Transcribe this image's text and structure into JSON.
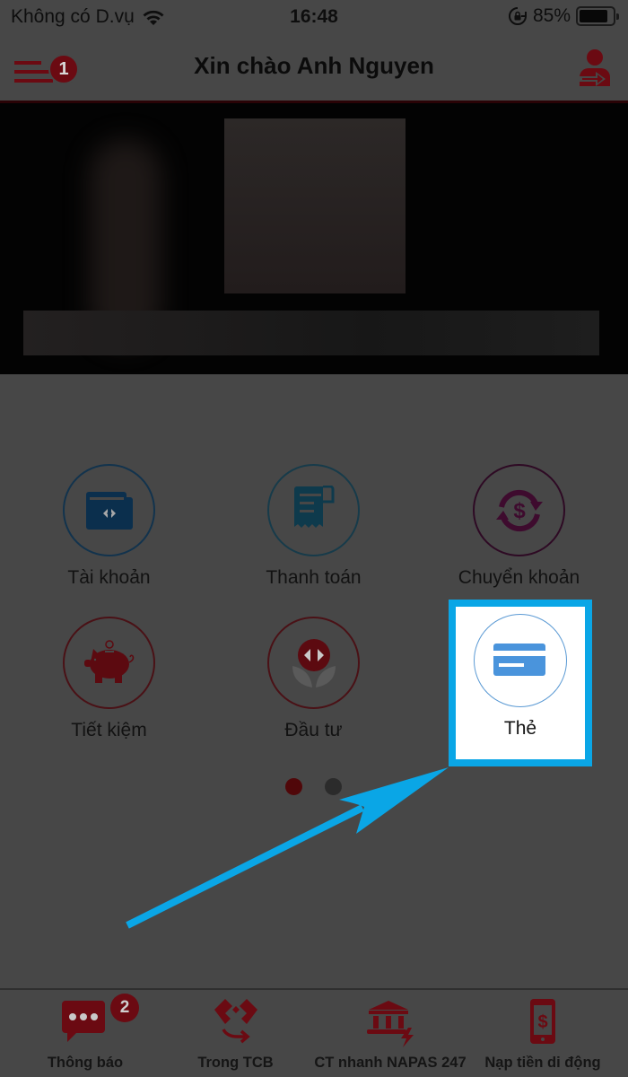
{
  "status_bar": {
    "carrier": "Không có D.vụ",
    "time": "16:48",
    "battery_percent_label": "85%",
    "battery_level": 0.85,
    "icons": [
      "wifi-icon",
      "rotation-lock-icon",
      "battery-icon"
    ]
  },
  "header": {
    "title": "Xin chào Anh Nguyen",
    "menu_badge": "1",
    "menu_icon": "hamburger-menu-icon",
    "logout_icon": "user-logout-icon"
  },
  "colors": {
    "brand_red": "#6b0a12",
    "overlay_bg": "#474747",
    "highlight_blue": "#0aa6e6",
    "card_blue": "#5b9ad4",
    "account_blue": "#0b2f4d",
    "payment_teal": "#0e3a4c",
    "transfer_purple": "#3e0b2e"
  },
  "features": [
    {
      "label": "Tài khoản",
      "icon": "wallet-icon"
    },
    {
      "label": "Thanh toán",
      "icon": "receipt-icon"
    },
    {
      "label": "Chuyển khoản",
      "icon": "money-exchange-icon"
    },
    {
      "label": "Tiết kiệm",
      "icon": "piggy-bank-icon"
    },
    {
      "label": "Đầu tư",
      "icon": "investment-plant-icon"
    },
    {
      "label": "Thẻ",
      "icon": "credit-card-icon",
      "highlighted": true
    }
  ],
  "pagination": {
    "current_page": 1,
    "total_pages": 2
  },
  "bottom_nav": [
    {
      "label": "Thông báo",
      "icon": "chat-bubble-icon",
      "badge": "2"
    },
    {
      "label": "Trong TCB",
      "icon": "tcb-transfer-icon"
    },
    {
      "label": "CT nhanh NAPAS 247",
      "icon": "bank-fast-transfer-icon"
    },
    {
      "label": "Nạp tiền di động",
      "icon": "mobile-topup-icon"
    }
  ]
}
